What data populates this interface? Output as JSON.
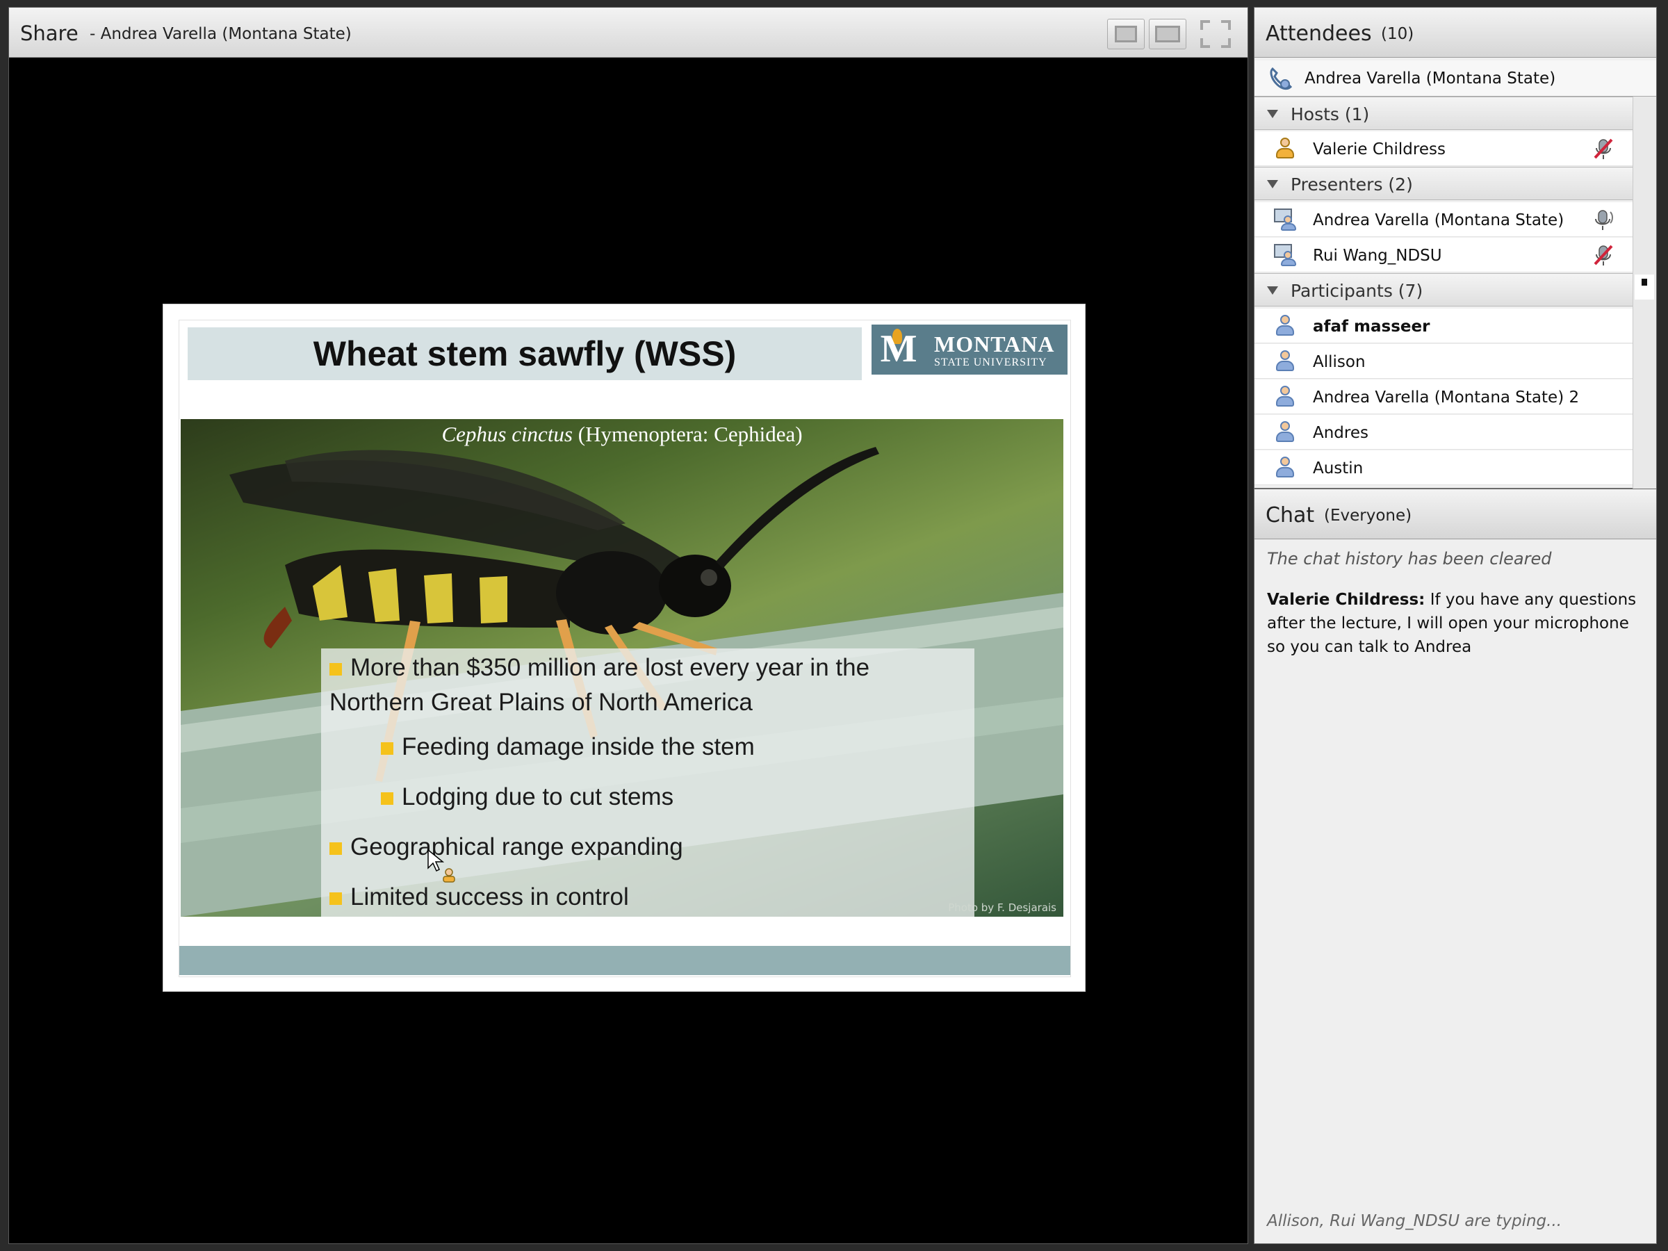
{
  "share": {
    "title": "Share",
    "presenter": "- Andrea Varella (Montana State)"
  },
  "slide": {
    "title": "Wheat stem sawfly (WSS)",
    "logo": {
      "letter": "M",
      "line1": "MONTANA",
      "line2": "STATE UNIVERSITY"
    },
    "caption_italic": "Cephus cinctus",
    "caption_rest": " (Hymenoptera: Cephidea)",
    "photo_credit": "Photo by F. Desjarais",
    "bullets": [
      {
        "text": "More than $350 million are lost every year in the",
        "level": 1
      },
      {
        "text": "Northern Great Plains of North America",
        "level": 0
      },
      {
        "text": "Feeding damage inside the stem",
        "level": 2
      },
      {
        "text": "Lodging due to cut stems",
        "level": 2
      },
      {
        "text": "Geographical range expanding",
        "level": 1
      },
      {
        "text": "Limited success in control",
        "level": 1
      }
    ]
  },
  "attendees": {
    "title": "Attendees",
    "count": "(10)",
    "me": "Andrea Varella (Montana State)",
    "groups": {
      "hosts": {
        "label": "Hosts (1)",
        "members": [
          "Valerie Childress"
        ]
      },
      "presenters": {
        "label": "Presenters (2)",
        "members": [
          "Andrea Varella (Montana State)",
          "Rui Wang_NDSU"
        ]
      },
      "participants": {
        "label": "Participants (7)",
        "members": [
          "afaf masseer",
          "Allison",
          "Andrea Varella (Montana State) 2",
          "Andres",
          "Austin"
        ]
      }
    }
  },
  "chat": {
    "title": "Chat",
    "scope": "(Everyone)",
    "cleared": "The chat history has been cleared",
    "sender": "Valerie Childress:",
    "message": " If you have any questions after the lecture, I will open your microphone so you can talk to Andrea",
    "typing": "Allison, Rui Wang_NDSU are typing..."
  },
  "colors": {
    "bullet": "#f5c21b",
    "slide_title_bar": "#d6e1e3",
    "logo_bg": "#5a7d8b",
    "mic_muted": "#d0243b"
  }
}
